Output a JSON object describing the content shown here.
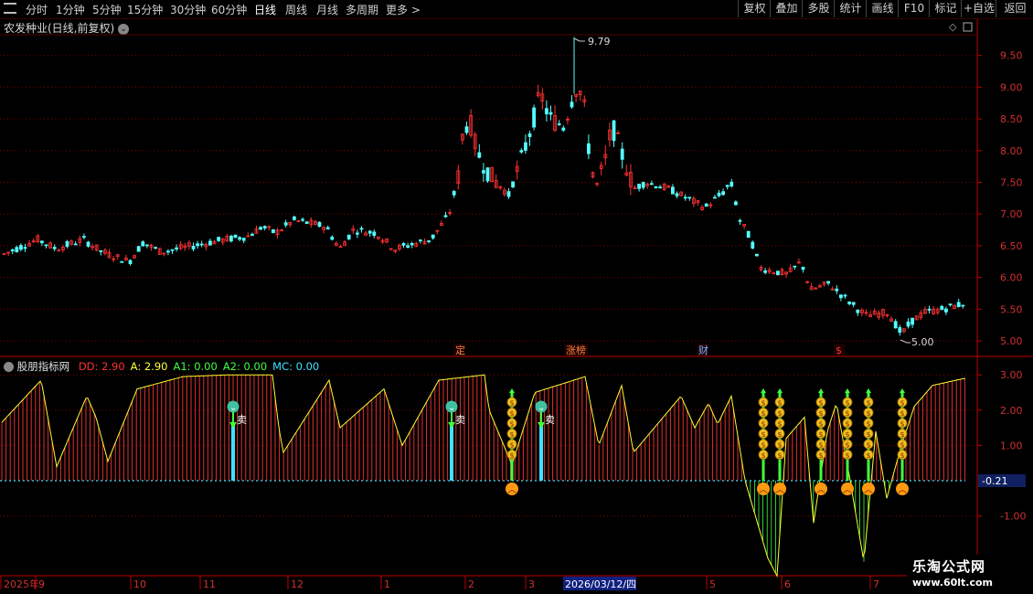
{
  "toolbar": {
    "periods": [
      {
        "label": "分时",
        "active": false
      },
      {
        "label": "1分钟",
        "active": false
      },
      {
        "label": "5分钟",
        "active": false
      },
      {
        "label": "15分钟",
        "active": false
      },
      {
        "label": "30分钟",
        "active": false
      },
      {
        "label": "60分钟",
        "active": false
      },
      {
        "label": "日线",
        "active": true
      },
      {
        "label": "周线",
        "active": false
      },
      {
        "label": "月线",
        "active": false
      },
      {
        "label": "多周期",
        "active": false
      },
      {
        "label": "更多 >",
        "active": false
      }
    ],
    "right_buttons": [
      "复权",
      "叠加",
      "多股",
      "统计",
      "画线",
      "F10",
      "标记",
      "+自选",
      "返回"
    ]
  },
  "stock": {
    "title": "农发种业(日线,前复权)",
    "high_label": "9.79",
    "low_label": "5.00",
    "price_axis": [
      "9.50",
      "9.00",
      "8.50",
      "8.00",
      "7.50",
      "7.00",
      "6.50",
      "6.00",
      "5.50",
      "5.00"
    ],
    "event_markers": [
      {
        "label": "定",
        "color": "#ff8040"
      },
      {
        "label": "涨榜",
        "color": "#ff8040"
      },
      {
        "label": "财",
        "color": "#7fb0ff"
      },
      {
        "label": "$",
        "color": "#ff3030"
      }
    ]
  },
  "indicator": {
    "name": "股朋指标网",
    "values": [
      {
        "key": "DD:",
        "val": "2.90",
        "color": "#ff3030"
      },
      {
        "key": "A:",
        "val": "2.90",
        "color": "#ffff40"
      },
      {
        "key": "A1:",
        "val": "0.00",
        "color": "#40ff40"
      },
      {
        "key": "A2:",
        "val": "0.00",
        "color": "#40ff40"
      },
      {
        "key": "MC:",
        "val": "0.00",
        "color": "#40e0ff"
      }
    ],
    "axis": [
      "3.00",
      "2.00",
      "1.00",
      "-1.00"
    ],
    "current_value": "-0.21",
    "sell_label": "卖"
  },
  "time_axis": {
    "labels": [
      "2025年",
      "9",
      "10",
      "11",
      "12",
      "1",
      "2",
      "3",
      "5",
      "6",
      "7"
    ],
    "highlight": "2026/03/12/四"
  },
  "watermark": {
    "brand": "乐淘公式网",
    "url": "www.60lt.com"
  },
  "colors": {
    "up": "#ff3232",
    "down": "#54ffff",
    "grid": "#800000",
    "axis": "#c00000"
  }
}
